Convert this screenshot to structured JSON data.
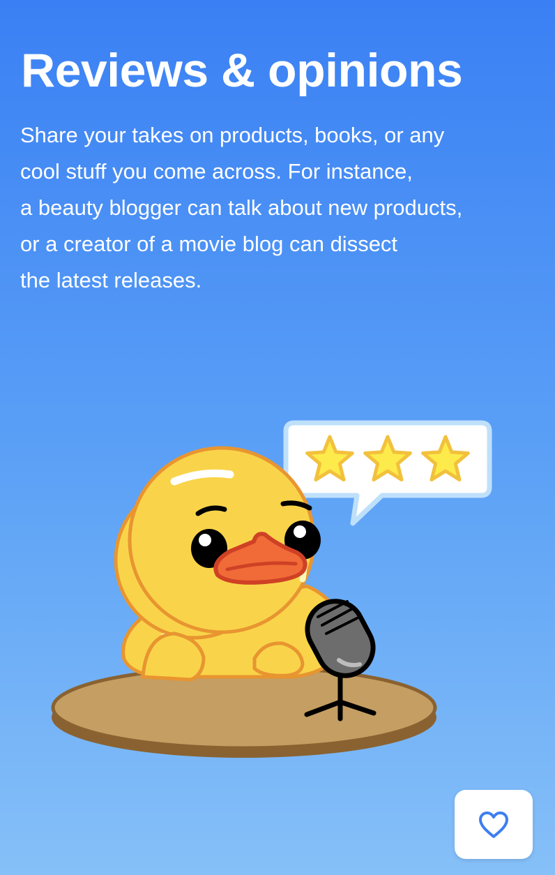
{
  "page": {
    "title": "Reviews & opinions",
    "description_lines": [
      "Share your takes on products, books, or any",
      "cool stuff you come across. For instance,",
      "a beauty blogger can talk about new products,",
      "or a creator of a movie blog can dissect",
      "the latest releases."
    ]
  },
  "illustration": {
    "rating_stars": 3,
    "icon": "duck-podcast-mascot"
  },
  "like_button": {
    "icon": "heart-icon"
  },
  "colors": {
    "background_top": "#3a80f4",
    "background_bottom": "#86c0f8",
    "heart_accent": "#3d7ef0",
    "duck_yellow": "#f9d44a",
    "star_yellow": "#fdeb4b"
  }
}
